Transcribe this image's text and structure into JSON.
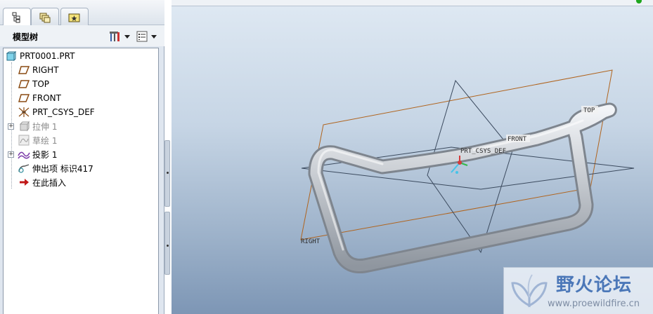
{
  "navigator": {
    "tabs": [
      {
        "name": "model-tree-tab-icon",
        "active": true
      },
      {
        "name": "folder-browser-tab-icon",
        "active": false
      },
      {
        "name": "favorites-tab-icon",
        "active": false
      }
    ],
    "tree_title": "模型树",
    "settings_icon": "tree-settings-icon",
    "show_icon": "tree-show-icon"
  },
  "tree": {
    "items": [
      {
        "label": "PRT0001.PRT",
        "icon": "part-icon"
      },
      {
        "label": "RIGHT",
        "icon": "datum-plane-icon"
      },
      {
        "label": "TOP",
        "icon": "datum-plane-icon"
      },
      {
        "label": "FRONT",
        "icon": "datum-plane-icon"
      },
      {
        "label": "PRT_CSYS_DEF",
        "icon": "csys-icon"
      },
      {
        "label": "拉伸 1",
        "icon": "extrude-icon",
        "suppressed": true
      },
      {
        "label": "草绘 1",
        "icon": "sketch-icon",
        "suppressed": true
      },
      {
        "label": "投影 1",
        "icon": "projection-icon"
      },
      {
        "label": "伸出项 标识417",
        "icon": "sweep-protrusion-icon"
      },
      {
        "label": "在此插入",
        "icon": "insert-here-arrow-icon"
      }
    ]
  },
  "viewport": {
    "labels": {
      "top": "TOP",
      "front": "FRONT",
      "right": "RIGHT",
      "csys": "PRT_CSYS_DEF"
    },
    "datum_color": "#b0641e",
    "axis_colors": {
      "x": "#d43b3b",
      "y": "#32b84a",
      "z": "#46c3e8"
    }
  },
  "watermark": {
    "title": "野火论坛",
    "url": "www.proewildfire.cn"
  },
  "colors": {
    "panel_bg": "#dfe6ef",
    "viewport_top": "#dfe9f3",
    "viewport_bottom": "#7d96b5"
  }
}
